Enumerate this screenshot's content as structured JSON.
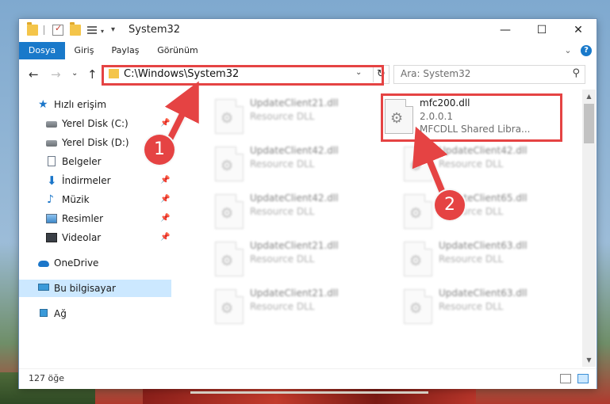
{
  "window": {
    "title": "System32"
  },
  "ribbon": {
    "tabs": [
      "Dosya",
      "Giriş",
      "Paylaş",
      "Görünüm"
    ],
    "help": "?"
  },
  "navbar": {
    "address": "C:\\Windows\\System32",
    "search_placeholder": "Ara: System32"
  },
  "sidebar": {
    "items": [
      {
        "label": "Hızlı erişim",
        "icon": "star-icon"
      },
      {
        "label": "Yerel Disk (C:)",
        "icon": "drive-icon"
      },
      {
        "label": "Yerel Disk (D:)",
        "icon": "drive-icon"
      },
      {
        "label": "Belgeler",
        "icon": "documents-icon"
      },
      {
        "label": "İndirmeler",
        "icon": "download-icon"
      },
      {
        "label": "Müzik",
        "icon": "music-icon"
      },
      {
        "label": "Resimler",
        "icon": "pictures-icon"
      },
      {
        "label": "Videolar",
        "icon": "video-icon"
      },
      {
        "label": "OneDrive",
        "icon": "cloud-icon"
      },
      {
        "label": "Bu bilgisayar",
        "icon": "computer-icon"
      },
      {
        "label": "Ağ",
        "icon": "network-icon"
      }
    ]
  },
  "files": {
    "highlighted": {
      "name": "mfc200.dll",
      "version": "2.0.0.1",
      "description": "MFCDLL Shared Libra..."
    },
    "others": [
      {
        "name": "UpdateClient21.dll",
        "description": "Resource DLL"
      },
      {
        "name": "UpdateClient42.dll",
        "description": "Resource DLL"
      },
      {
        "name": "UpdateClient42.dll",
        "description": "Resource DLL"
      },
      {
        "name": "UpdateClient42.dll",
        "description": "Resource DLL"
      },
      {
        "name": "UpdateClient65.dll",
        "description": "Resource DLL"
      },
      {
        "name": "UpdateClient21.dll",
        "description": "Resource DLL"
      },
      {
        "name": "UpdateClient63.dll",
        "description": "Resource DLL"
      },
      {
        "name": "UpdateClient21.dll",
        "description": "Resource DLL"
      },
      {
        "name": "UpdateClient63.dll",
        "description": "Resource DLL"
      }
    ]
  },
  "status": {
    "item_count": "127 öğe"
  },
  "annotations": {
    "step1": "1",
    "step2": "2",
    "color": "#e54343"
  }
}
